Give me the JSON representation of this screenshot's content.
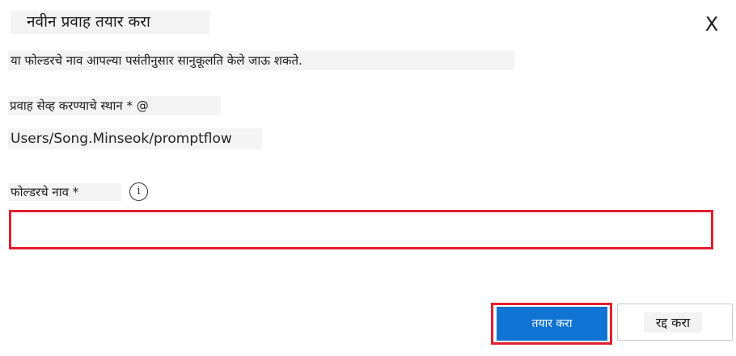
{
  "dialog": {
    "title": "नवीन प्रवाह तयार करा",
    "close_label": "X",
    "description": "या फोल्डरचे नाव आपल्या पसंतीनुसार सानुकूलति केले जाऊ शकते."
  },
  "location": {
    "label": "प्रवाह सेव्ह करण्याचे स्थान * @",
    "value": "Users/Song.Minseok/promptflow"
  },
  "folder": {
    "label": "फोल्डरचे नाव *",
    "info_glyph": "i",
    "value": "",
    "placeholder": ""
  },
  "actions": {
    "create_label": "तयार करा",
    "cancel_label": "रद्द करा"
  },
  "colors": {
    "primary": "#0f74d4",
    "highlight": "#e0202f",
    "label_background": "#f3f3f3"
  },
  "icons": {
    "close": "close-icon",
    "info": "info-icon"
  }
}
